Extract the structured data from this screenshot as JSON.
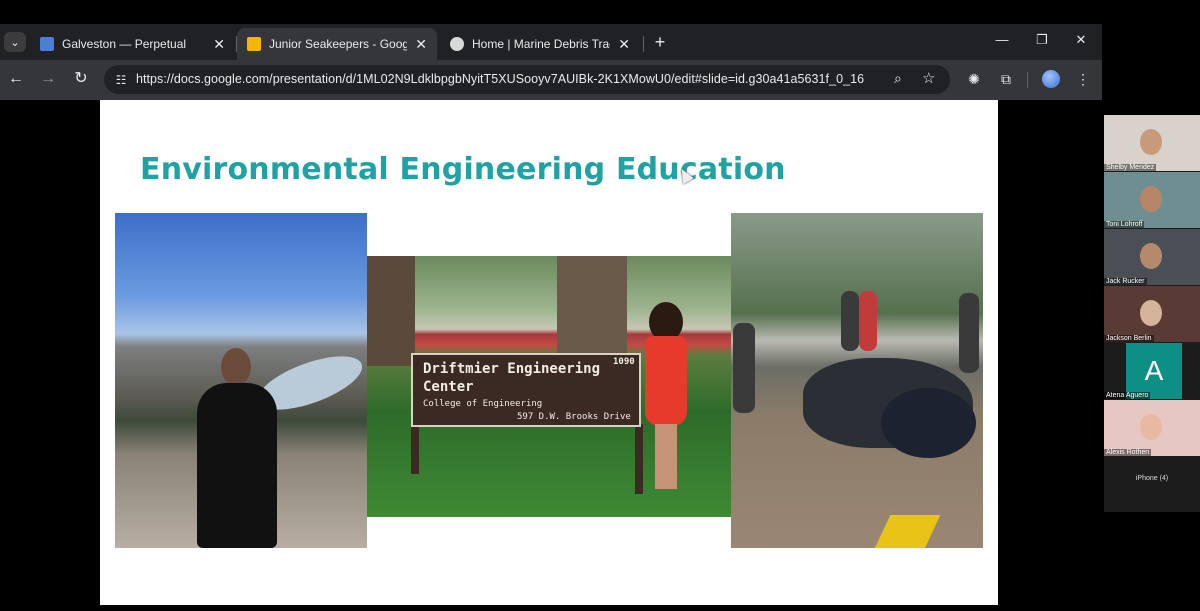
{
  "browser": {
    "tabs": [
      {
        "title": "Galveston — Perpetual",
        "favicon_color": "#4a7fd4",
        "active": false
      },
      {
        "title": "Junior Seakeepers - Google Slides",
        "favicon_color": "#f4b400",
        "active": true
      },
      {
        "title": "Home | Marine Debris Tracker",
        "favicon_color": "#d8d8d8",
        "active": false
      }
    ],
    "url": "https://docs.google.com/presentation/d/1ML02N9LdklbpgbNyitT5XUSooyv7AUIBk-2K1XMowU0/edit#slide=id.g30a41a5631f_0_16"
  },
  "slide": {
    "title": "Environmental Engineering Education",
    "title_color": "#1fa2a3",
    "photos": {
      "sign": {
        "line1": "Driftmier Engineering",
        "number": "1090",
        "line2": "Center",
        "line3": "College of Engineering",
        "line4": "597 D.W. Brooks Drive"
      }
    }
  },
  "call": {
    "participants": [
      {
        "name": "Shelby Mendez"
      },
      {
        "name": "Toni Lohroff"
      },
      {
        "name": "Jack Rucker"
      },
      {
        "name": "Jackson Berlin"
      },
      {
        "name": "Atena Aguero",
        "initial": "A"
      },
      {
        "name": "Alexis Rothen"
      }
    ],
    "device_label": "iPhone (4)"
  }
}
